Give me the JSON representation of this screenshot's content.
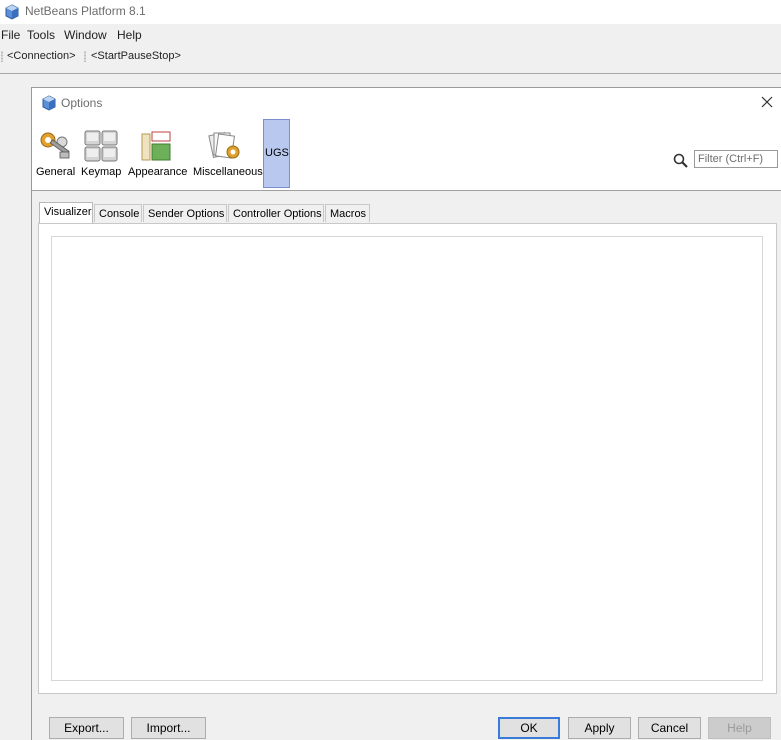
{
  "app": {
    "title": "NetBeans Platform 8.1"
  },
  "menu": {
    "items": [
      "File",
      "Tools",
      "Window",
      "Help"
    ]
  },
  "toolbar": {
    "items": [
      "<Connection>",
      "<StartPauseStop>"
    ]
  },
  "dialog": {
    "title": "Options",
    "categories": [
      {
        "label": "General",
        "icon": "gears-icon"
      },
      {
        "label": "Keymap",
        "icon": "keymap-icon"
      },
      {
        "label": "Appearance",
        "icon": "appearance-icon"
      },
      {
        "label": "Miscellaneous",
        "icon": "miscellaneous-icon"
      },
      {
        "label": "UGS",
        "icon": "",
        "selected": true
      }
    ],
    "filter": {
      "placeholder": "Filter (Ctrl+F)",
      "value": ""
    },
    "tabs": [
      {
        "label": "Visualizer",
        "active": true
      },
      {
        "label": "Console"
      },
      {
        "label": "Sender Options"
      },
      {
        "label": "Controller Options"
      },
      {
        "label": "Macros"
      }
    ],
    "buttons": {
      "export": "Export...",
      "import": "Import...",
      "ok": "OK",
      "apply": "Apply",
      "cancel": "Cancel",
      "help": "Help"
    }
  }
}
